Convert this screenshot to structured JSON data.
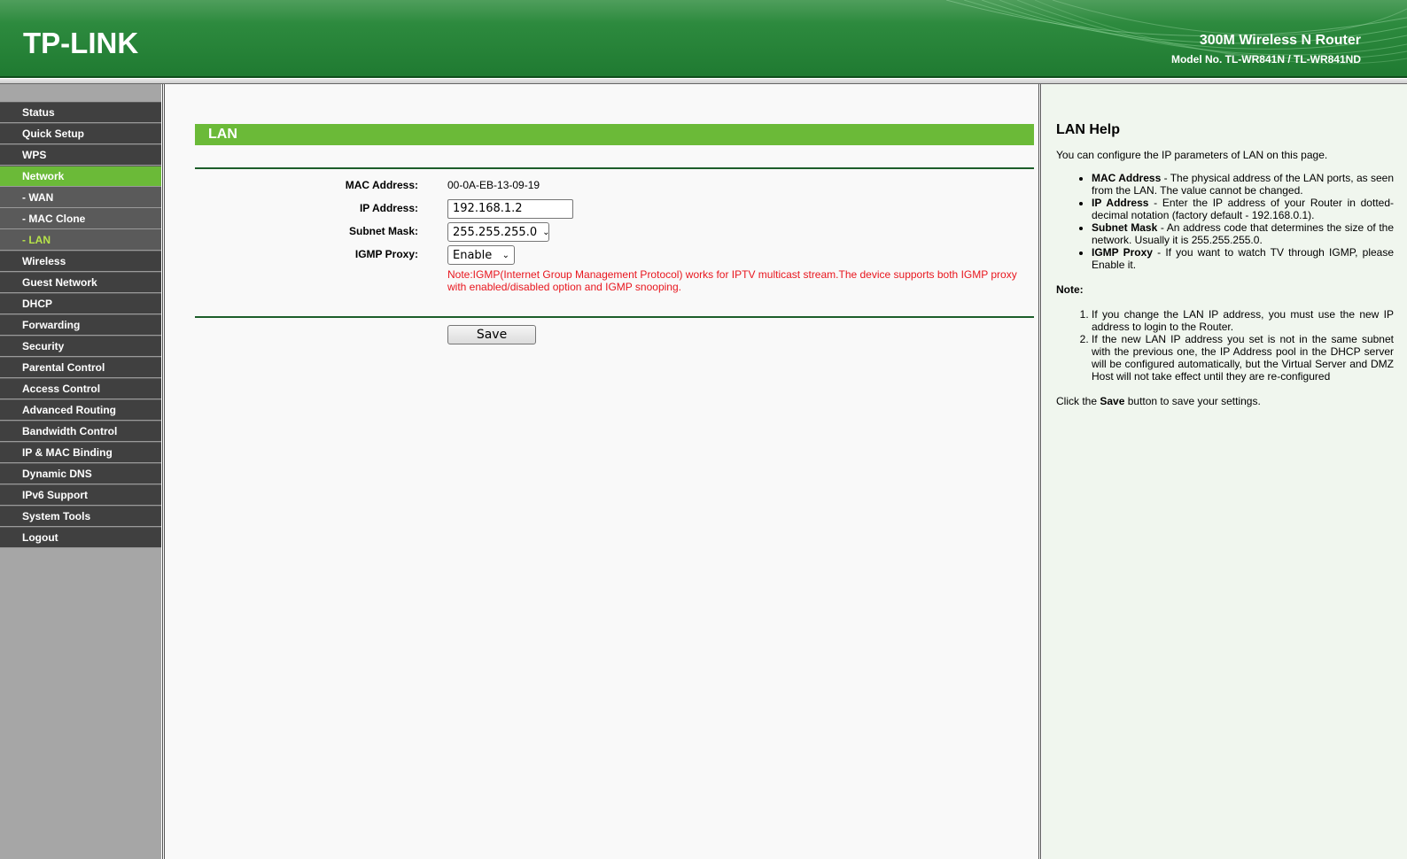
{
  "header": {
    "logo": "TP-LINK",
    "product_name": "300M Wireless N Router",
    "model_no": "Model No. TL-WR841N / TL-WR841ND"
  },
  "sidebar": {
    "items": [
      {
        "label": "Status"
      },
      {
        "label": "Quick Setup"
      },
      {
        "label": "WPS"
      },
      {
        "label": "Network"
      },
      {
        "label": "- WAN"
      },
      {
        "label": "- MAC Clone"
      },
      {
        "label": "- LAN"
      },
      {
        "label": "Wireless"
      },
      {
        "label": "Guest Network"
      },
      {
        "label": "DHCP"
      },
      {
        "label": "Forwarding"
      },
      {
        "label": "Security"
      },
      {
        "label": "Parental Control"
      },
      {
        "label": "Access Control"
      },
      {
        "label": "Advanced Routing"
      },
      {
        "label": "Bandwidth Control"
      },
      {
        "label": "IP & MAC Binding"
      },
      {
        "label": "Dynamic DNS"
      },
      {
        "label": "IPv6 Support"
      },
      {
        "label": "System Tools"
      },
      {
        "label": "Logout"
      }
    ]
  },
  "main": {
    "title": "LAN",
    "mac_label": "MAC Address:",
    "mac_value": "00-0A-EB-13-09-19",
    "ip_label": "IP Address:",
    "ip_value": "192.168.1.2",
    "subnet_label": "Subnet Mask:",
    "subnet_value": "255.255.255.0",
    "igmp_label": "IGMP Proxy:",
    "igmp_value": "Enable",
    "note": "Note:IGMP(Internet Group Management Protocol) works for IPTV multicast stream.The device supports both IGMP proxy with enabled/disabled option and IGMP snooping.",
    "save_label": "Save"
  },
  "help": {
    "title": "LAN Help",
    "intro": "You can configure the IP parameters of LAN on this page.",
    "bullets": [
      {
        "term": "MAC Address",
        "text": " - The physical address of the LAN ports, as seen from the LAN. The value cannot be changed."
      },
      {
        "term": "IP Address",
        "text": " - Enter the IP address of your Router in dotted-decimal notation (factory default - 192.168.0.1)."
      },
      {
        "term": "Subnet Mask",
        "text": " - An address code that determines the size of the network. Usually it is 255.255.255.0."
      },
      {
        "term": "IGMP Proxy",
        "text": " - If you want to watch TV through IGMP, please Enable it."
      }
    ],
    "note_title": "Note:",
    "notes": [
      "If you change the LAN IP address, you must use the new IP address to login to the Router.",
      "If the new LAN IP address you set is not in the same subnet with the previous one, the IP Address pool in the DHCP server will be configured automatically, but the Virtual Server and DMZ Host will not take effect until they are re-configured"
    ],
    "footer_pre": "Click the ",
    "footer_bold": "Save",
    "footer_post": " button to save your settings."
  }
}
